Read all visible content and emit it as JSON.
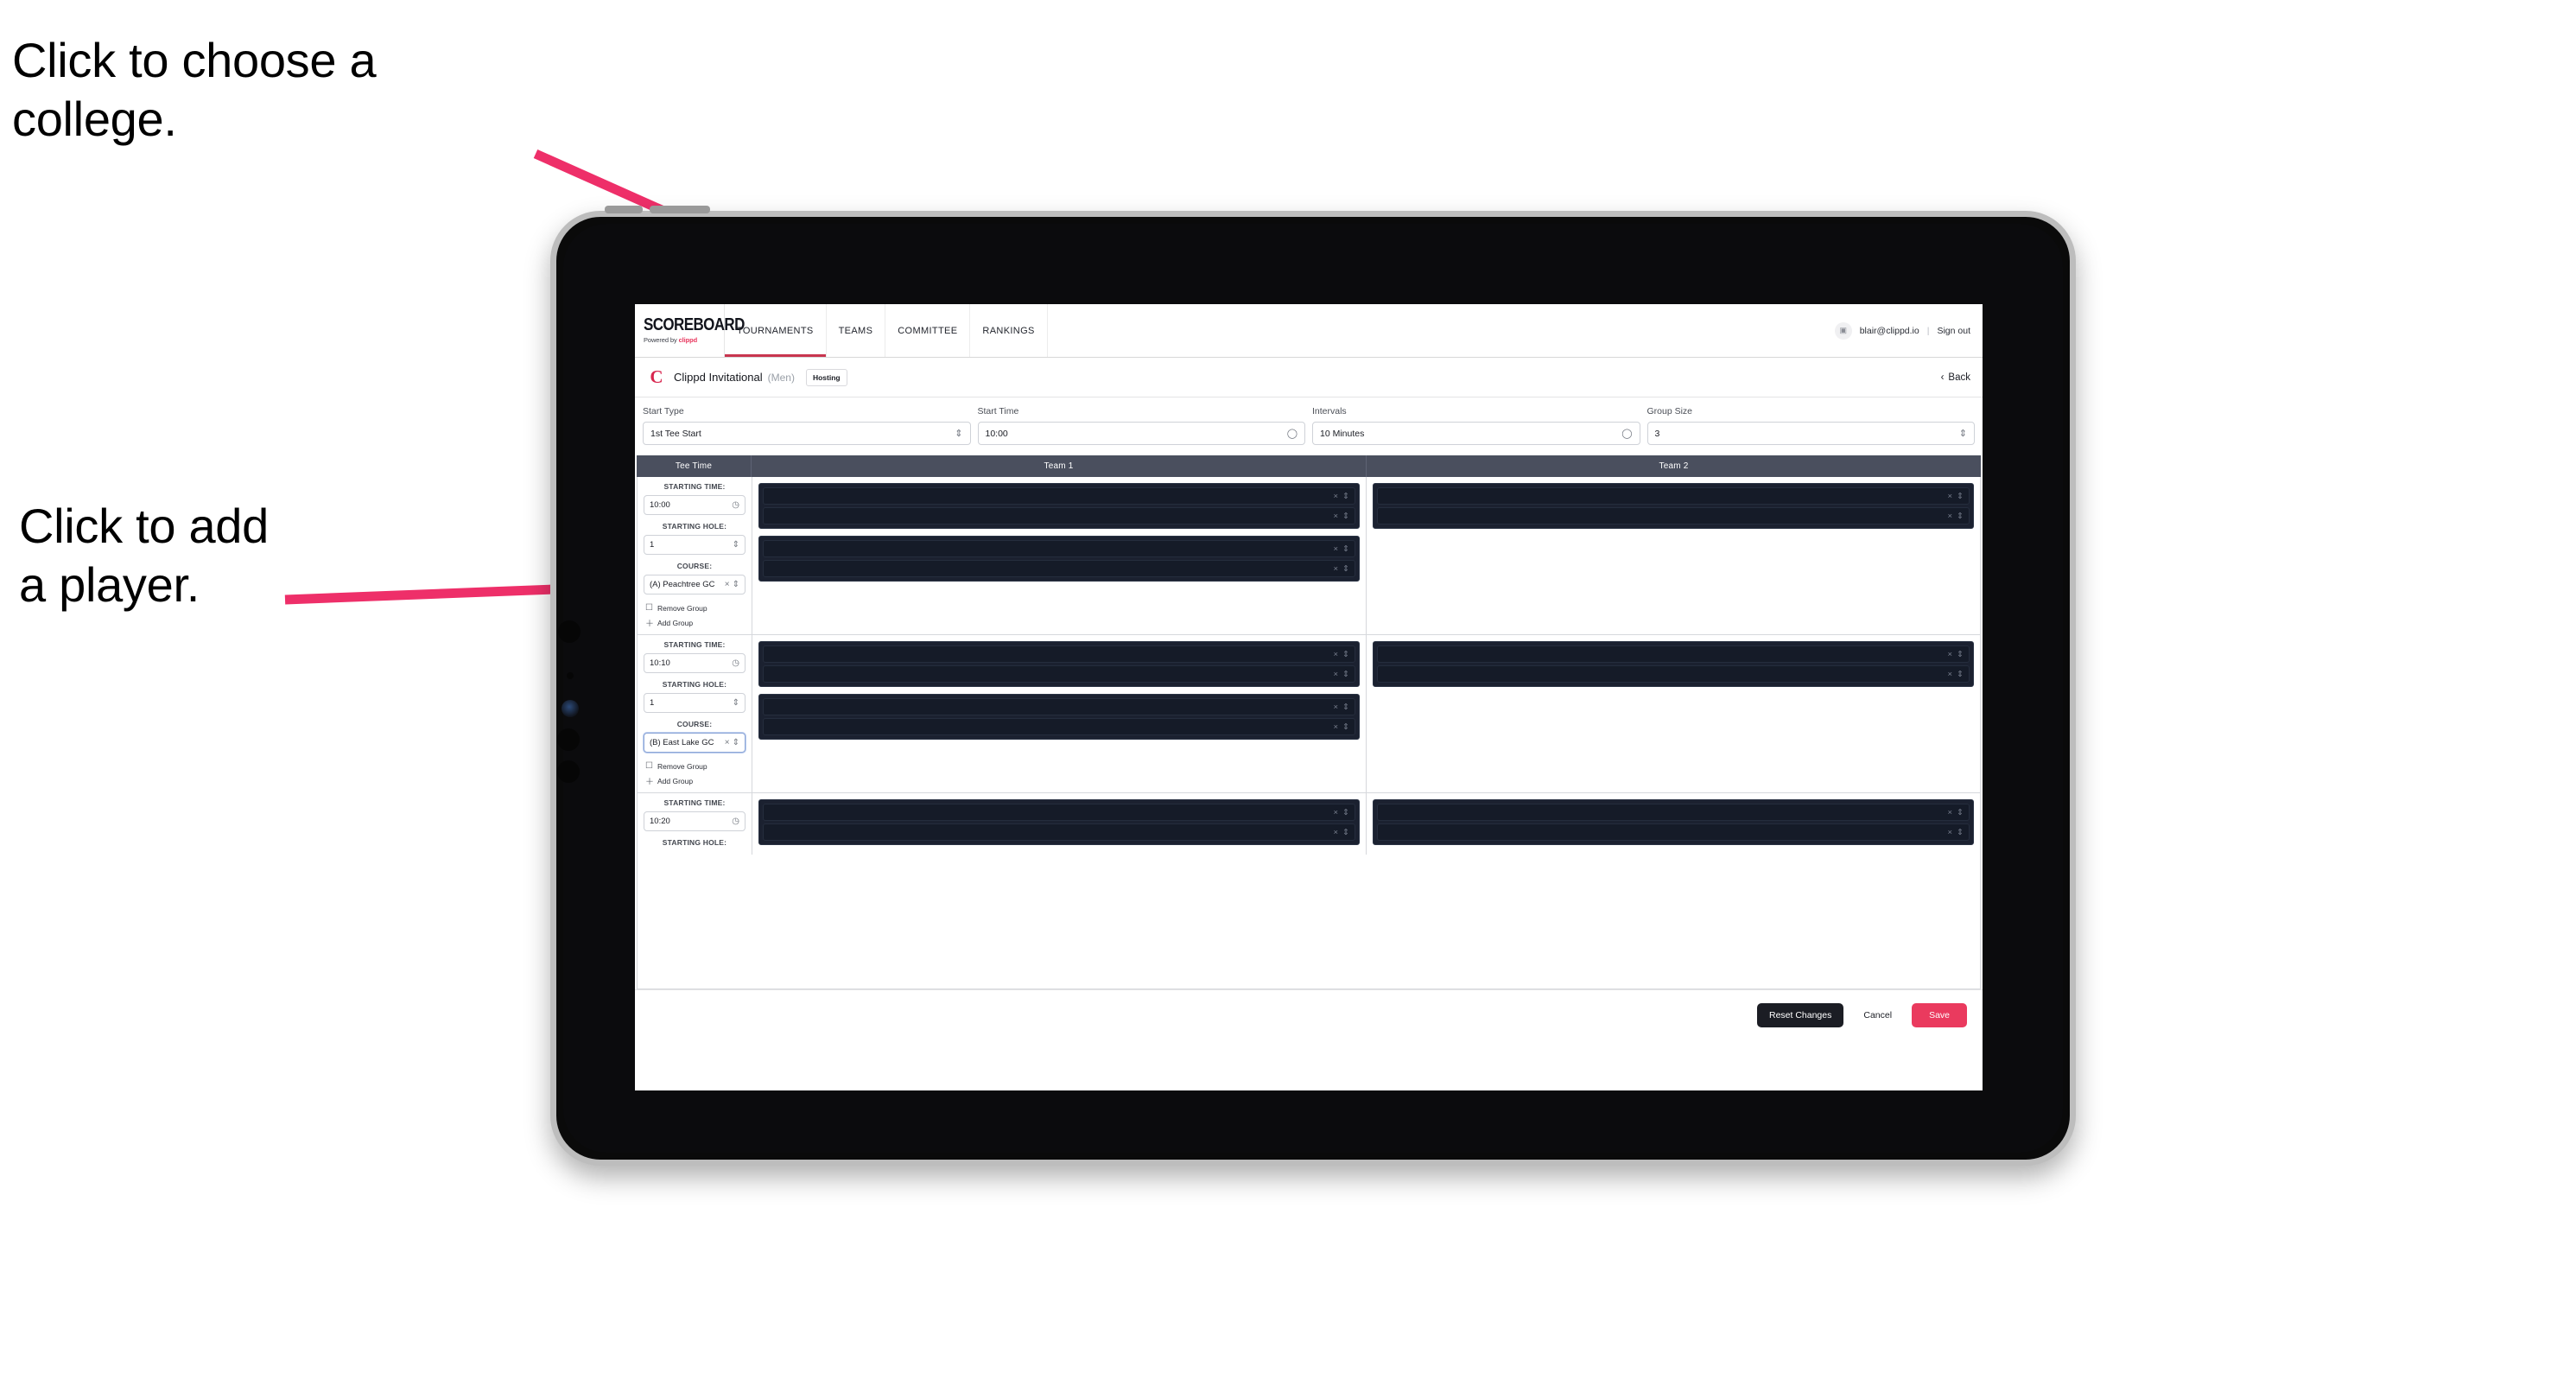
{
  "annotations": {
    "college": "Click to choose a\ncollege.",
    "player": "Click to add\na player."
  },
  "colors": {
    "accent_pink": "#ea3a5e",
    "brand_red": "#c8354f",
    "header_slate": "#4a4f5e",
    "slot_dark": "#151b28"
  },
  "topnav": {
    "brand_word": "SCOREBOARD",
    "brand_sub_prefix": "Powered by ",
    "brand_sub_name": "clippd",
    "items": [
      {
        "label": "TOURNAMENTS",
        "active": true
      },
      {
        "label": "TEAMS",
        "active": false
      },
      {
        "label": "COMMITTEE",
        "active": false
      },
      {
        "label": "RANKINGS",
        "active": false
      }
    ],
    "account": {
      "avatar_icon": "user-avatar-icon",
      "email": "blair@clippd.io",
      "separator": "|",
      "signout": "Sign out"
    }
  },
  "tournament_bar": {
    "logo_letter": "C",
    "name": "Clippd Invitational",
    "gender": "(Men)",
    "role_badge": "Hosting",
    "back_chevron": "‹",
    "back_label": "Back"
  },
  "settings": [
    {
      "label": "Start Type",
      "value": "1st Tee Start",
      "icon": "chevron-updown-icon"
    },
    {
      "label": "Start Time",
      "value": "10:00",
      "icon": "clock-icon"
    },
    {
      "label": "Intervals",
      "value": "10 Minutes",
      "icon": "clock-icon"
    },
    {
      "label": "Group Size",
      "value": "3",
      "icon": "chevron-updown-icon"
    }
  ],
  "grid": {
    "headers": {
      "tee_time": "Tee Time",
      "team1": "Team 1",
      "team2": "Team 2"
    },
    "field_labels": {
      "starting_time": "STARTING TIME:",
      "starting_hole": "STARTING HOLE:",
      "course": "COURSE:"
    },
    "group_actions": {
      "remove": "Remove Group",
      "add": "Add Group",
      "remove_icon": "trash-icon",
      "add_icon": "plus-icon"
    },
    "slot_icons": {
      "clear": "close-x-icon",
      "stepper": "chevron-updown-icon"
    },
    "rows": [
      {
        "starting_time": "10:00",
        "starting_hole": "1",
        "course": "(A) Peachtree GC",
        "course_focused": false,
        "team1_groups": [
          {
            "slots": [
              "",
              ""
            ]
          },
          {
            "slots": [
              "",
              ""
            ]
          }
        ],
        "team2_groups": [
          {
            "slots": [
              "",
              ""
            ]
          }
        ]
      },
      {
        "starting_time": "10:10",
        "starting_hole": "1",
        "course": "(B) East Lake GC",
        "course_focused": true,
        "team1_groups": [
          {
            "slots": [
              "",
              ""
            ]
          },
          {
            "slots": [
              "",
              ""
            ]
          }
        ],
        "team2_groups": [
          {
            "slots": [
              "",
              ""
            ]
          }
        ]
      },
      {
        "starting_time": "10:20",
        "starting_hole": "",
        "course": "",
        "course_focused": false,
        "team1_groups": [
          {
            "slots": [
              "",
              ""
            ]
          }
        ],
        "team2_groups": [
          {
            "slots": [
              "",
              ""
            ]
          }
        ]
      }
    ]
  },
  "footer": {
    "reset": "Reset Changes",
    "cancel": "Cancel",
    "save": "Save"
  }
}
